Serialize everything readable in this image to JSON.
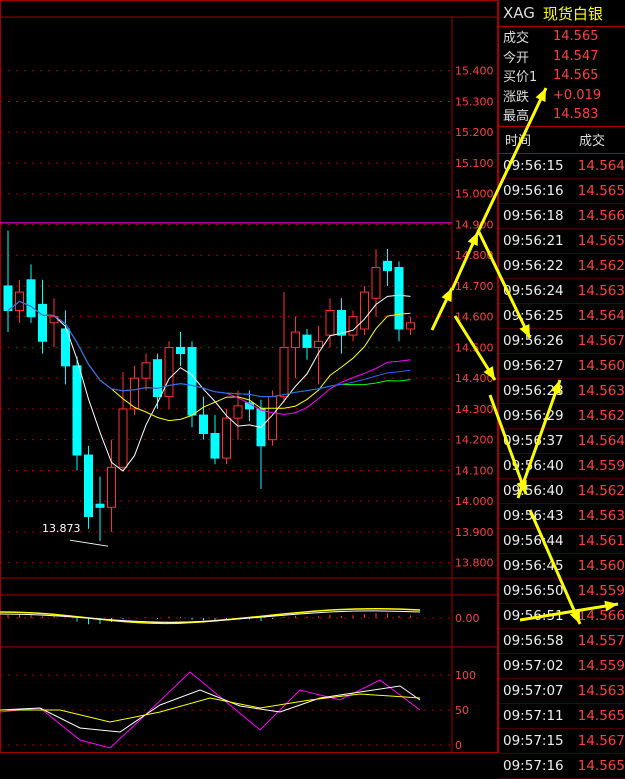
{
  "symbol": "XAG",
  "instrument_name": "现货白银",
  "quote": [
    {
      "label": "成交",
      "value": "14.565"
    },
    {
      "label": "今开",
      "value": "14.547"
    },
    {
      "label": "买价1",
      "value": "14.565"
    },
    {
      "label": "涨跌",
      "value": "+0.019"
    },
    {
      "label": "最高",
      "value": "14.583"
    }
  ],
  "tick_header": {
    "time": "时间",
    "price": "成交"
  },
  "ticks": [
    {
      "time": "09:56:15",
      "price": "14.564"
    },
    {
      "time": "09:56:16",
      "price": "14.565"
    },
    {
      "time": "09:56:18",
      "price": "14.566"
    },
    {
      "time": "09:56:21",
      "price": "14.565"
    },
    {
      "time": "09:56:22",
      "price": "14.562"
    },
    {
      "time": "09:56:24",
      "price": "14.563"
    },
    {
      "time": "09:56:25",
      "price": "14.564"
    },
    {
      "time": "09:56:26",
      "price": "14.567"
    },
    {
      "time": "09:56:27",
      "price": "14.560"
    },
    {
      "time": "09:56:28",
      "price": "14.563"
    },
    {
      "time": "09:56:29",
      "price": "14.562"
    },
    {
      "time": "09:56:37",
      "price": "14.564"
    },
    {
      "time": "09:56:40",
      "price": "14.559"
    },
    {
      "time": "09:56:40",
      "price": "14.562"
    },
    {
      "time": "09:56:43",
      "price": "14.563"
    },
    {
      "time": "09:56:44",
      "price": "14.561"
    },
    {
      "time": "09:56:45",
      "price": "14.560"
    },
    {
      "time": "09:56:50",
      "price": "14.559"
    },
    {
      "time": "09:56:51",
      "price": "14.566"
    },
    {
      "time": "09:56:58",
      "price": "14.557"
    },
    {
      "time": "09:57:02",
      "price": "14.559"
    },
    {
      "time": "09:57:07",
      "price": "14.563"
    },
    {
      "time": "09:57:11",
      "price": "14.565"
    },
    {
      "time": "09:57:15",
      "price": "14.567"
    },
    {
      "time": "09:57:16",
      "price": "14.565"
    }
  ],
  "chart_data": {
    "type": "candlestick",
    "price_axis_ticks": [
      "15.400",
      "15.300",
      "15.200",
      "15.100",
      "15.000",
      "14.900",
      "14.800",
      "14.700",
      "14.600",
      "14.500",
      "14.400",
      "14.300",
      "14.200",
      "14.100",
      "14.000",
      "13.900",
      "13.800"
    ],
    "ylim": [
      13.75,
      15.5
    ],
    "low_annotation": "13.873",
    "candles": [
      {
        "o": 14.7,
        "h": 14.88,
        "l": 14.55,
        "c": 14.62
      },
      {
        "o": 14.62,
        "h": 14.72,
        "l": 14.58,
        "c": 14.68
      },
      {
        "o": 14.72,
        "h": 14.77,
        "l": 14.58,
        "c": 14.6
      },
      {
        "o": 14.64,
        "h": 14.72,
        "l": 14.48,
        "c": 14.52
      },
      {
        "o": 14.58,
        "h": 14.66,
        "l": 14.5,
        "c": 14.6
      },
      {
        "o": 14.56,
        "h": 14.62,
        "l": 14.38,
        "c": 14.44
      },
      {
        "o": 14.44,
        "h": 14.47,
        "l": 14.1,
        "c": 14.15
      },
      {
        "o": 14.15,
        "h": 14.18,
        "l": 13.91,
        "c": 13.95
      },
      {
        "o": 13.99,
        "h": 14.08,
        "l": 13.87,
        "c": 13.98
      },
      {
        "o": 13.98,
        "h": 14.2,
        "l": 13.9,
        "c": 14.11
      },
      {
        "o": 14.11,
        "h": 14.42,
        "l": 14.1,
        "c": 14.3
      },
      {
        "o": 14.3,
        "h": 14.44,
        "l": 14.28,
        "c": 14.4
      },
      {
        "o": 14.4,
        "h": 14.48,
        "l": 14.36,
        "c": 14.45
      },
      {
        "o": 14.46,
        "h": 14.48,
        "l": 14.3,
        "c": 14.34
      },
      {
        "o": 14.34,
        "h": 14.52,
        "l": 14.3,
        "c": 14.5
      },
      {
        "o": 14.5,
        "h": 14.55,
        "l": 14.44,
        "c": 14.48
      },
      {
        "o": 14.5,
        "h": 14.52,
        "l": 14.24,
        "c": 14.28
      },
      {
        "o": 14.28,
        "h": 14.34,
        "l": 14.2,
        "c": 14.22
      },
      {
        "o": 14.22,
        "h": 14.28,
        "l": 14.12,
        "c": 14.14
      },
      {
        "o": 14.14,
        "h": 14.3,
        "l": 14.12,
        "c": 14.27
      },
      {
        "o": 14.27,
        "h": 14.36,
        "l": 14.2,
        "c": 14.31
      },
      {
        "o": 14.32,
        "h": 14.36,
        "l": 14.26,
        "c": 14.3
      },
      {
        "o": 14.3,
        "h": 14.33,
        "l": 14.04,
        "c": 14.18
      },
      {
        "o": 14.2,
        "h": 14.36,
        "l": 14.18,
        "c": 14.34
      },
      {
        "o": 14.34,
        "h": 14.68,
        "l": 14.32,
        "c": 14.5
      },
      {
        "o": 14.5,
        "h": 14.6,
        "l": 14.4,
        "c": 14.55
      },
      {
        "o": 14.54,
        "h": 14.56,
        "l": 14.46,
        "c": 14.5
      },
      {
        "o": 14.5,
        "h": 14.57,
        "l": 14.38,
        "c": 14.52
      },
      {
        "o": 14.54,
        "h": 14.66,
        "l": 14.5,
        "c": 14.62
      },
      {
        "o": 14.62,
        "h": 14.66,
        "l": 14.48,
        "c": 14.54
      },
      {
        "o": 14.54,
        "h": 14.62,
        "l": 14.52,
        "c": 14.6
      },
      {
        "o": 14.56,
        "h": 14.7,
        "l": 14.54,
        "c": 14.68
      },
      {
        "o": 14.66,
        "h": 14.82,
        "l": 14.6,
        "c": 14.76
      },
      {
        "o": 14.78,
        "h": 14.82,
        "l": 14.7,
        "c": 14.75
      },
      {
        "o": 14.76,
        "h": 14.78,
        "l": 14.52,
        "c": 14.56
      },
      {
        "o": 14.56,
        "h": 14.6,
        "l": 14.54,
        "c": 14.58
      }
    ],
    "hline": 14.905,
    "macd_axis_tick": "0.00",
    "kdj_axis_ticks": [
      "100",
      "50",
      "0"
    ],
    "colors": {
      "up": "#ff3030",
      "down": "#00ffff",
      "ma5": "#ffffff",
      "ma10": "#ffff00",
      "ma20": "#ff00ff",
      "ma30": "#00ff00",
      "ma60": "#3060ff",
      "grid": "#a00000",
      "arrow": "#ffff00"
    }
  }
}
